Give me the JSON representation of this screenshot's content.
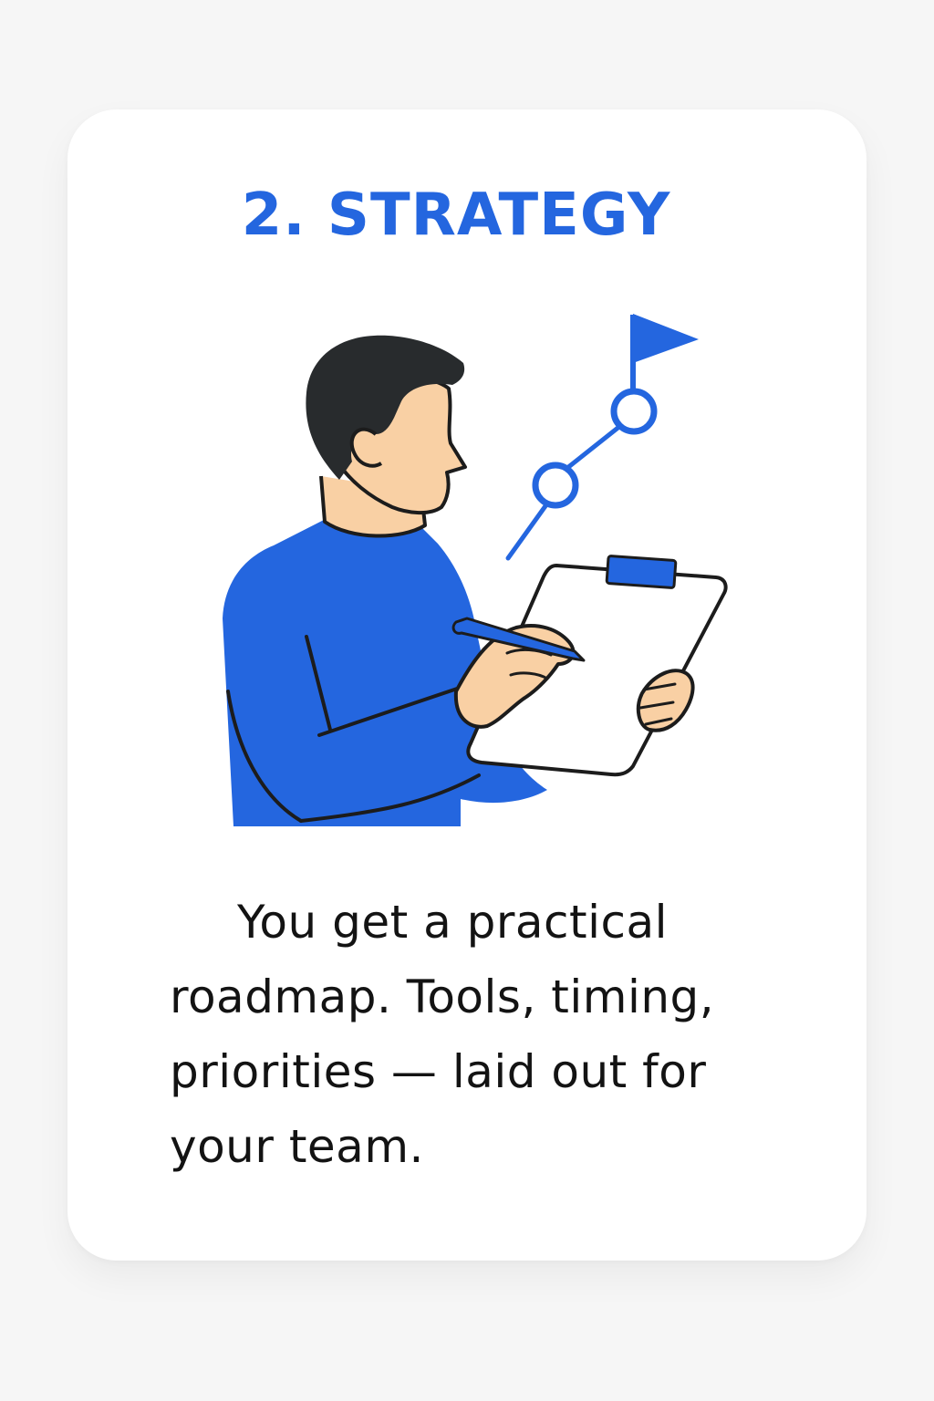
{
  "card": {
    "title": "2. STRATEGY",
    "body": "You get a practical roadmap. Tools, timing, priorities — laid out for your team."
  },
  "illustration": {
    "subject": "person-writing-on-clipboard",
    "icons": [
      "flag-icon",
      "milestone-path-icon",
      "clipboard-icon",
      "pen-icon"
    ]
  },
  "colors": {
    "accent": "#2466df",
    "skin": "#f9d0a4",
    "hair": "#282b2d",
    "outline": "#1c1c1c",
    "background": "#f6f6f6",
    "card": "#ffffff"
  }
}
